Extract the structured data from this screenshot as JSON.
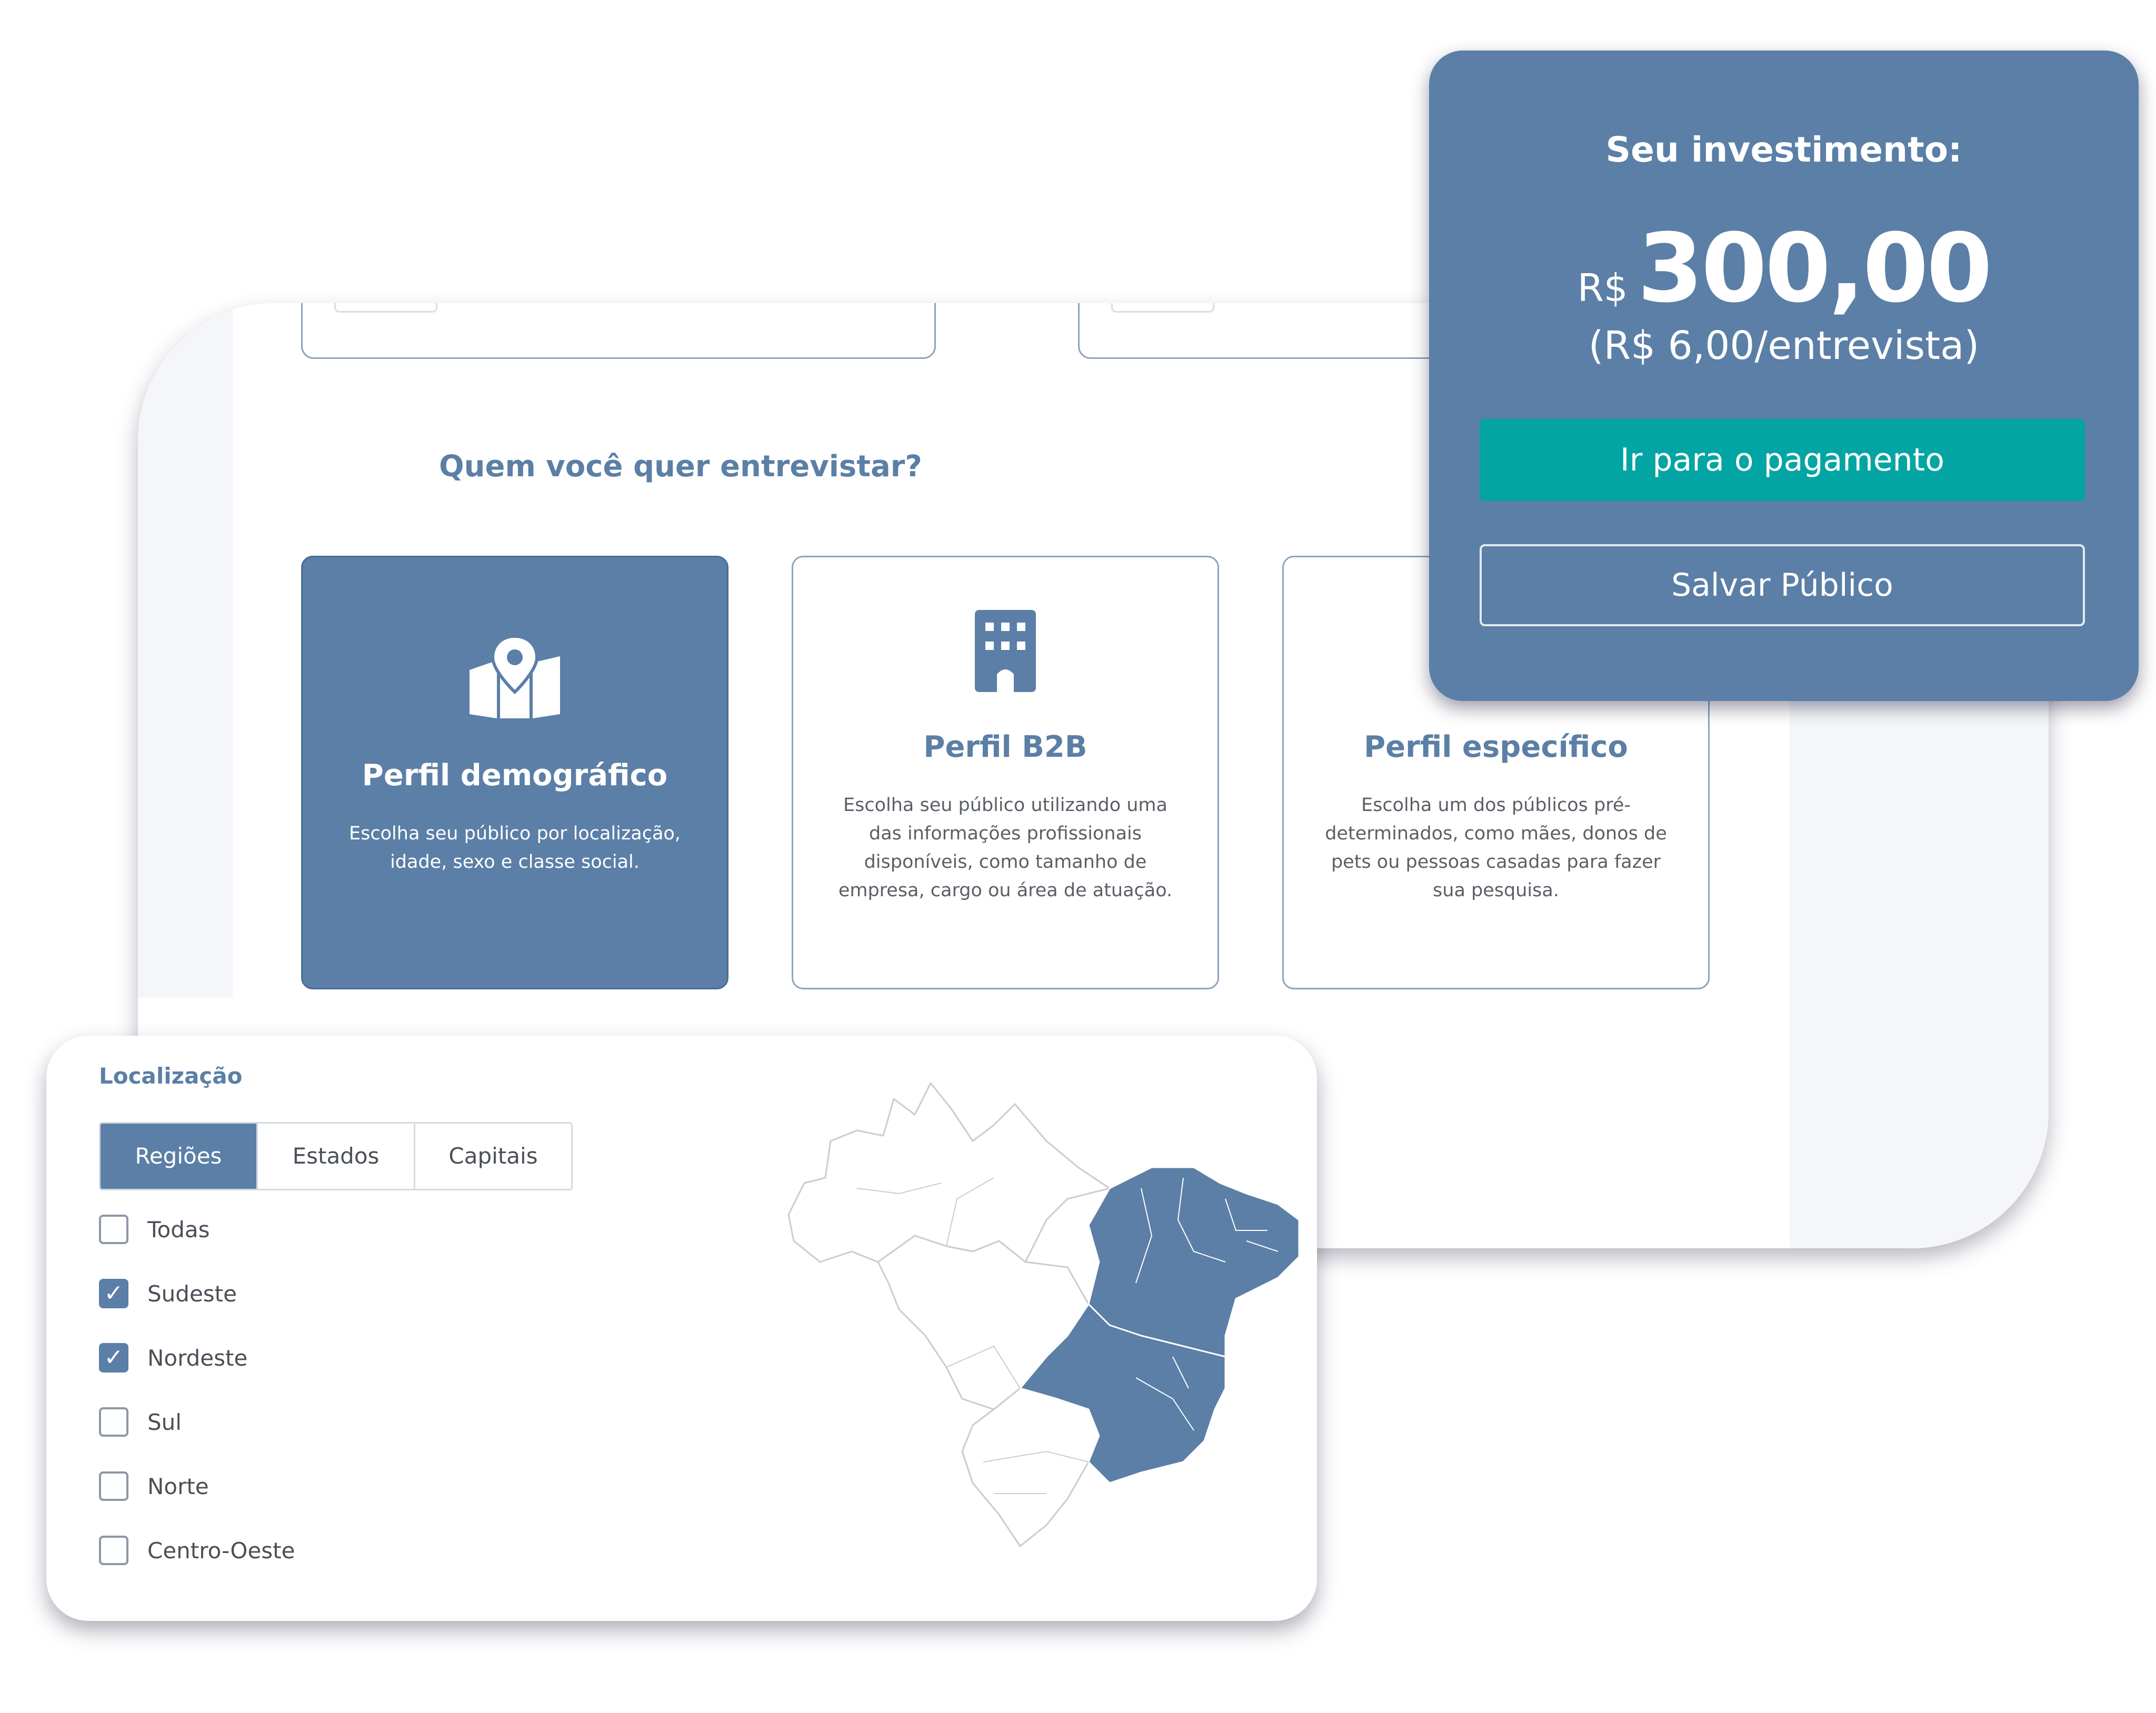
{
  "main": {
    "section_title": "Quem você quer entrevistar?",
    "profile_cards": [
      {
        "title": "Perfil demográfico",
        "description": "Escolha seu público por localização, idade, sexo e classe social.",
        "icon": "map-pin-icon",
        "selected": true
      },
      {
        "title": "Perfil B2B",
        "description": "Escolha seu público utilizando uma das informações profissionais disponíveis, como tamanho de empresa, cargo ou área de atuação.",
        "icon": "building-icon",
        "selected": false
      },
      {
        "title": "Perfil específico",
        "description": "Escolha um dos públicos pré-determinados, como mães, donos de pets ou pessoas casadas para fazer sua pesquisa.",
        "icon": "",
        "selected": false
      }
    ]
  },
  "investment": {
    "title": "Seu investimento:",
    "currency": "R$",
    "amount": "300,00",
    "per_interview": "(R$ 6,00/entrevista)",
    "pay_button": "Ir para o pagamento",
    "save_button": "Salvar Público"
  },
  "location": {
    "title": "Localização",
    "tabs": [
      {
        "label": "Regiões",
        "active": true
      },
      {
        "label": "Estados",
        "active": false
      },
      {
        "label": "Capitais",
        "active": false
      }
    ],
    "regions": [
      {
        "label": "Todas",
        "checked": false
      },
      {
        "label": "Sudeste",
        "checked": true
      },
      {
        "label": "Nordeste",
        "checked": true
      },
      {
        "label": "Sul",
        "checked": false
      },
      {
        "label": "Norte",
        "checked": false
      },
      {
        "label": "Centro-Oeste",
        "checked": false
      }
    ],
    "map": {
      "highlighted_regions": [
        "Sudeste",
        "Nordeste"
      ],
      "highlight_color": "#5b7fa6",
      "base_color": "#ffffff",
      "border_color": "#c9ccd1"
    }
  },
  "colors": {
    "primary": "#5b7fa6",
    "accent_teal": "#02a5a3",
    "background_gutter": "#f5f6fa"
  }
}
